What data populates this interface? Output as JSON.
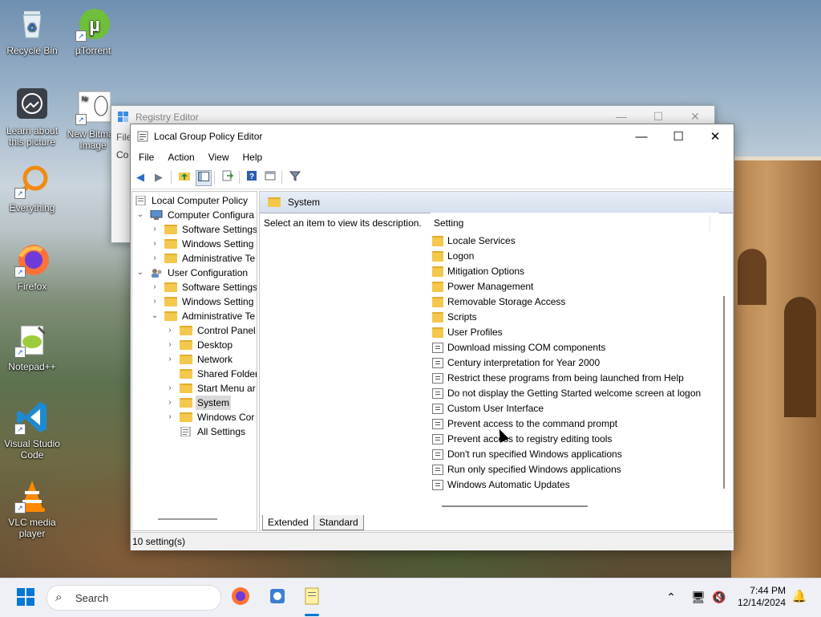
{
  "desktop": {
    "icons": [
      {
        "label": "Recycle Bin",
        "icon": "recycle-bin-icon"
      },
      {
        "label": "µTorrent",
        "icon": "utorrent-icon"
      },
      {
        "label": "Learn about this picture",
        "icon": "learn-picture-icon"
      },
      {
        "label": "New Bitmap Image",
        "icon": "bitmap-image-icon"
      },
      {
        "label": "Everything",
        "icon": "everything-search-icon"
      },
      {
        "label": "Firefox",
        "icon": "firefox-icon"
      },
      {
        "label": "Notepad++",
        "icon": "notepadpp-icon"
      },
      {
        "label": "Visual Studio Code",
        "icon": "vscode-icon"
      },
      {
        "label": "VLC media player",
        "icon": "vlc-icon"
      }
    ]
  },
  "background_window": {
    "title": "Registry Editor",
    "menu_partial": "File",
    "address_partial": "Co"
  },
  "window": {
    "title": "Local Group Policy Editor",
    "controls": {
      "minimize": "—",
      "maximize": "☐",
      "close": "✕"
    },
    "menu": [
      "File",
      "Action",
      "View",
      "Help"
    ],
    "toolbar_icons": [
      "back-arrow-icon",
      "forward-arrow-icon",
      "up-folder-icon",
      "show-hide-tree-icon",
      "export-list-icon",
      "help-icon",
      "properties-icon",
      "filter-icon"
    ],
    "tree": {
      "root": "Local Computer Policy",
      "computer_config": "Computer Configura",
      "cc_software": "Software Settings",
      "cc_windows": "Windows Setting",
      "cc_admin": "Administrative Te",
      "user_config": "User Configuration",
      "uc_software": "Software Settings",
      "uc_windows": "Windows Setting",
      "uc_admin": "Administrative Te",
      "control_panel": "Control Panel",
      "desktop": "Desktop",
      "network": "Network",
      "shared_folders": "Shared Folder",
      "start_menu": "Start Menu ar",
      "system": "System",
      "windows_components": "Windows Cor",
      "all_settings": "All Settings"
    },
    "right_header": "System",
    "description": "Select an item to view its description.",
    "column_header": "Setting",
    "folders": [
      "Locale Services",
      "Logon",
      "Mitigation Options",
      "Power Management",
      "Removable Storage Access",
      "Scripts",
      "User Profiles"
    ],
    "policies": [
      "Download missing COM components",
      "Century interpretation for Year 2000",
      "Restrict these programs from being launched from Help",
      "Do not display the Getting Started welcome screen at logon",
      "Custom User Interface",
      "Prevent access to the command prompt",
      "Prevent access to registry editing tools",
      "Don't run specified Windows applications",
      "Run only specified Windows applications",
      "Windows Automatic Updates"
    ],
    "tabs": [
      "Extended",
      "Standard"
    ],
    "status": "10 setting(s)"
  },
  "taskbar": {
    "search_placeholder": "Search",
    "time": "7:44 PM",
    "date": "12/14/2024"
  },
  "colors": {
    "folder": "#f4c84c",
    "header_blue": "#d5dfee",
    "taskbar_bg": "#eef0f6",
    "accent_blue": "#0078d4"
  }
}
